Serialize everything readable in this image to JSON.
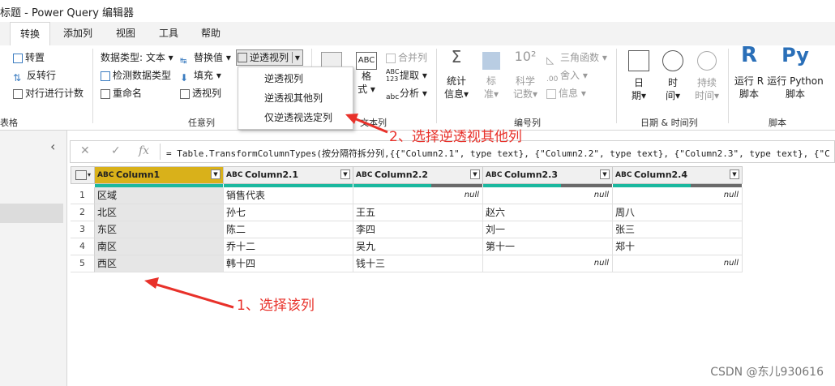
{
  "window": {
    "title": "标题 - Power Query 编辑器"
  },
  "tabs": [
    "转换",
    "添加列",
    "视图",
    "工具",
    "帮助"
  ],
  "ribbon": {
    "table_group": {
      "transpose": "转置",
      "reverse_rows": "反转行",
      "count_rows": "对行进行计数",
      "label": "表格"
    },
    "any_column_group": {
      "data_type": "数据类型: 文本",
      "detect_type": "检测数据类型",
      "rename": "重命名",
      "replace_values": "替换值",
      "fill": "填充",
      "pivot": "透视列",
      "unpivot": "逆透视列",
      "label": "任意列"
    },
    "text_column_group": {
      "merge_columns": "合并列",
      "extract": "提取",
      "parse": "分析",
      "format": "格",
      "format2": "式",
      "label": "文本列"
    },
    "number_column_group": {
      "statistics": "统计",
      "statistics2": "信息",
      "standard": "标",
      "standard2": "准",
      "scientific": "科学",
      "scientific2": "记数",
      "trig": "三角函数",
      "rounding": "舍入",
      "information": "信息",
      "label": "编号列"
    },
    "datetime_group": {
      "date": "日",
      "date2": "期",
      "time": "时",
      "time2": "间",
      "duration": "持续",
      "duration2": "时间",
      "label": "日期 & 时间列"
    },
    "script_group": {
      "run_r": "运行 R",
      "run_r2": "脚本",
      "run_py": "运行 Python",
      "run_py2": "脚本",
      "label": "脚本"
    }
  },
  "unpivot_menu": [
    "逆透视列",
    "逆透视其他列",
    "仅逆透视选定列"
  ],
  "formula_bar": {
    "text": "= Table.TransformColumnTypes(按分隔符拆分列,{{\"Column2.1\", type text}, {\"Column2.2\", type text}, {\"Column2.3\", type text}, {\"C"
  },
  "table": {
    "columns": [
      {
        "name": "Column1",
        "type": "ABC"
      },
      {
        "name": "Column2.1",
        "type": "ABC"
      },
      {
        "name": "Column2.2",
        "type": "ABC"
      },
      {
        "name": "Column2.3",
        "type": "ABC"
      },
      {
        "name": "Column2.4",
        "type": "ABC"
      }
    ],
    "rows": [
      [
        "1",
        "区域",
        "销售代表",
        "null",
        "null",
        "null"
      ],
      [
        "2",
        "北区",
        "孙七",
        "王五",
        "赵六",
        "周八"
      ],
      [
        "3",
        "东区",
        "陈二",
        "李四",
        "刘一",
        "张三"
      ],
      [
        "4",
        "南区",
        "乔十二",
        "吴九",
        "第十一",
        "郑十"
      ],
      [
        "5",
        "西区",
        "韩十四",
        "钱十三",
        "null",
        "null"
      ]
    ]
  },
  "annotations": {
    "step1": "1、选择该列",
    "step2": "2、选择逆透视其他列"
  },
  "watermark": "CSDN @东儿930616",
  "colors": {
    "selected_header": "#d9b11a",
    "annotation": "#e8312a",
    "quality_green": "#1bb89f"
  }
}
